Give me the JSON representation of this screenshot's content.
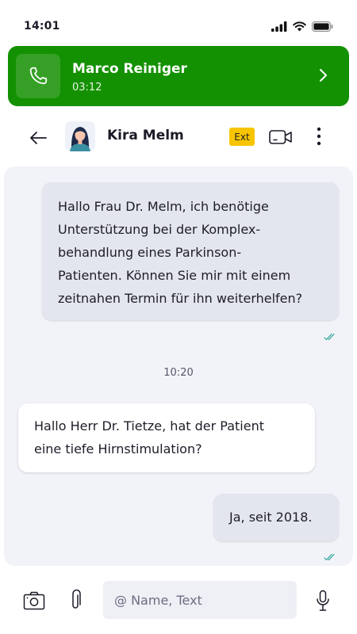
{
  "status_bar": {
    "time": "14:01",
    "icons": [
      "signal-icon",
      "wifi-icon",
      "battery-icon"
    ]
  },
  "call_banner": {
    "caller_name": "Marco Reiniger",
    "duration": "03:12",
    "icon": "phone-icon",
    "background_color": "#149102"
  },
  "chat_header": {
    "contact_name": "Kira Melm",
    "badge": "Ext",
    "badge_color": "#f7c500",
    "icons": [
      "back-arrow-icon",
      "avatar",
      "video-camera-icon",
      "more-vertical-icon"
    ]
  },
  "conversation": {
    "messages": [
      {
        "direction": "outgoing",
        "lines": [
          "Hallo Frau Dr. Melm, ich benötige",
          "Unterstützung bei der Komplex-",
          "behandlung eines Parkinson-",
          "Patienten. Können Sie mir mit einem",
          "zeitnahen Termin für ihn weiterhelfen?"
        ],
        "read": true
      },
      {
        "direction": "incoming",
        "lines": [
          "Hallo Herr Dr. Tietze, hat der Patient",
          "eine tiefe Hirnstimulation?"
        ]
      },
      {
        "direction": "outgoing",
        "lines": [
          "Ja, seit 2018."
        ],
        "read": true
      }
    ],
    "time_divider": "10:20",
    "read_tick_color": "#2aa69a"
  },
  "composer": {
    "placeholder": "@ Name, Text",
    "value": "",
    "icons": [
      "camera-icon",
      "paperclip-icon",
      "microphone-icon"
    ]
  }
}
